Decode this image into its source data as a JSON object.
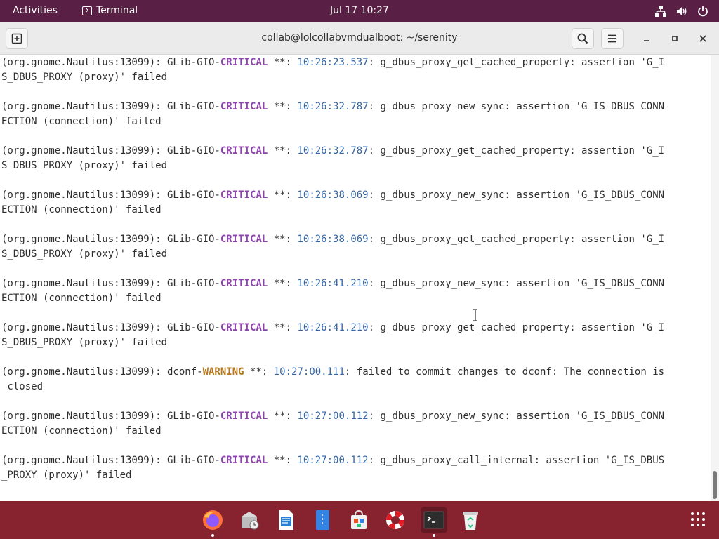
{
  "topbar": {
    "activities": "Activities",
    "app_name": "Terminal",
    "clock": "Jul 17  10:27"
  },
  "window": {
    "title": "collab@lolcollabvmdualboot: ~/serenity"
  },
  "terminal": {
    "lines": [
      [
        {
          "t": "(org.gnome.Nautilus:13099): GLib-GIO-"
        },
        {
          "t": "CRITICAL",
          "c": "crit"
        },
        {
          "t": " **: "
        },
        {
          "t": "10:26:23.537",
          "c": "ts"
        },
        {
          "t": ": g_dbus_proxy_get_cached_property: assertion 'G_I"
        }
      ],
      [
        {
          "t": "S_DBUS_PROXY (proxy)' failed"
        }
      ],
      [],
      [
        {
          "t": "(org.gnome.Nautilus:13099): GLib-GIO-"
        },
        {
          "t": "CRITICAL",
          "c": "crit"
        },
        {
          "t": " **: "
        },
        {
          "t": "10:26:32.787",
          "c": "ts"
        },
        {
          "t": ": g_dbus_proxy_new_sync: assertion 'G_IS_DBUS_CONN"
        }
      ],
      [
        {
          "t": "ECTION (connection)' failed"
        }
      ],
      [],
      [
        {
          "t": "(org.gnome.Nautilus:13099): GLib-GIO-"
        },
        {
          "t": "CRITICAL",
          "c": "crit"
        },
        {
          "t": " **: "
        },
        {
          "t": "10:26:32.787",
          "c": "ts"
        },
        {
          "t": ": g_dbus_proxy_get_cached_property: assertion 'G_I"
        }
      ],
      [
        {
          "t": "S_DBUS_PROXY (proxy)' failed"
        }
      ],
      [],
      [
        {
          "t": "(org.gnome.Nautilus:13099): GLib-GIO-"
        },
        {
          "t": "CRITICAL",
          "c": "crit"
        },
        {
          "t": " **: "
        },
        {
          "t": "10:26:38.069",
          "c": "ts"
        },
        {
          "t": ": g_dbus_proxy_new_sync: assertion 'G_IS_DBUS_CONN"
        }
      ],
      [
        {
          "t": "ECTION (connection)' failed"
        }
      ],
      [],
      [
        {
          "t": "(org.gnome.Nautilus:13099): GLib-GIO-"
        },
        {
          "t": "CRITICAL",
          "c": "crit"
        },
        {
          "t": " **: "
        },
        {
          "t": "10:26:38.069",
          "c": "ts"
        },
        {
          "t": ": g_dbus_proxy_get_cached_property: assertion 'G_I"
        }
      ],
      [
        {
          "t": "S_DBUS_PROXY (proxy)' failed"
        }
      ],
      [],
      [
        {
          "t": "(org.gnome.Nautilus:13099): GLib-GIO-"
        },
        {
          "t": "CRITICAL",
          "c": "crit"
        },
        {
          "t": " **: "
        },
        {
          "t": "10:26:41.210",
          "c": "ts"
        },
        {
          "t": ": g_dbus_proxy_new_sync: assertion 'G_IS_DBUS_CONN"
        }
      ],
      [
        {
          "t": "ECTION (connection)' failed"
        }
      ],
      [],
      [
        {
          "t": "(org.gnome.Nautilus:13099): GLib-GIO-"
        },
        {
          "t": "CRITICAL",
          "c": "crit"
        },
        {
          "t": " **: "
        },
        {
          "t": "10:26:41.210",
          "c": "ts"
        },
        {
          "t": ": g_dbus_proxy_get_cached_property: assertion 'G_I"
        }
      ],
      [
        {
          "t": "S_DBUS_PROXY (proxy)' failed"
        }
      ],
      [],
      [
        {
          "t": "(org.gnome.Nautilus:13099): dconf-"
        },
        {
          "t": "WARNING",
          "c": "warn"
        },
        {
          "t": " **: "
        },
        {
          "t": "10:27:00.111",
          "c": "ts"
        },
        {
          "t": ": failed to commit changes to dconf: The connection is"
        }
      ],
      [
        {
          "t": " closed"
        }
      ],
      [],
      [
        {
          "t": "(org.gnome.Nautilus:13099): GLib-GIO-"
        },
        {
          "t": "CRITICAL",
          "c": "crit"
        },
        {
          "t": " **: "
        },
        {
          "t": "10:27:00.112",
          "c": "ts"
        },
        {
          "t": ": g_dbus_proxy_new_sync: assertion 'G_IS_DBUS_CONN"
        }
      ],
      [
        {
          "t": "ECTION (connection)' failed"
        }
      ],
      [],
      [
        {
          "t": "(org.gnome.Nautilus:13099): GLib-GIO-"
        },
        {
          "t": "CRITICAL",
          "c": "crit"
        },
        {
          "t": " **: "
        },
        {
          "t": "10:27:00.112",
          "c": "ts"
        },
        {
          "t": ": g_dbus_proxy_call_internal: assertion 'G_IS_DBUS"
        }
      ],
      [
        {
          "t": "_PROXY (proxy)' failed"
        }
      ]
    ]
  },
  "dock": {
    "items": [
      {
        "name": "firefox",
        "icon": "firefox-icon",
        "running": true,
        "active": false
      },
      {
        "name": "backups",
        "icon": "backups-icon",
        "running": false,
        "active": false
      },
      {
        "name": "writer",
        "icon": "libreoffice-writer-icon",
        "running": false,
        "active": false
      },
      {
        "name": "text-editor",
        "icon": "text-editor-icon",
        "running": false,
        "active": false
      },
      {
        "name": "software",
        "icon": "software-center-icon",
        "running": false,
        "active": false
      },
      {
        "name": "help",
        "icon": "help-lifebuoy-icon",
        "running": false,
        "active": false
      },
      {
        "name": "terminal",
        "icon": "terminal-icon",
        "running": true,
        "active": true
      },
      {
        "name": "trash",
        "icon": "trash-icon",
        "running": false,
        "active": false
      }
    ]
  },
  "colors": {
    "topbar": "#5a1f45",
    "dock": "#87222f",
    "critical": "#8e44ad",
    "warning": "#b7791f",
    "timestamp": "#3465a4"
  }
}
